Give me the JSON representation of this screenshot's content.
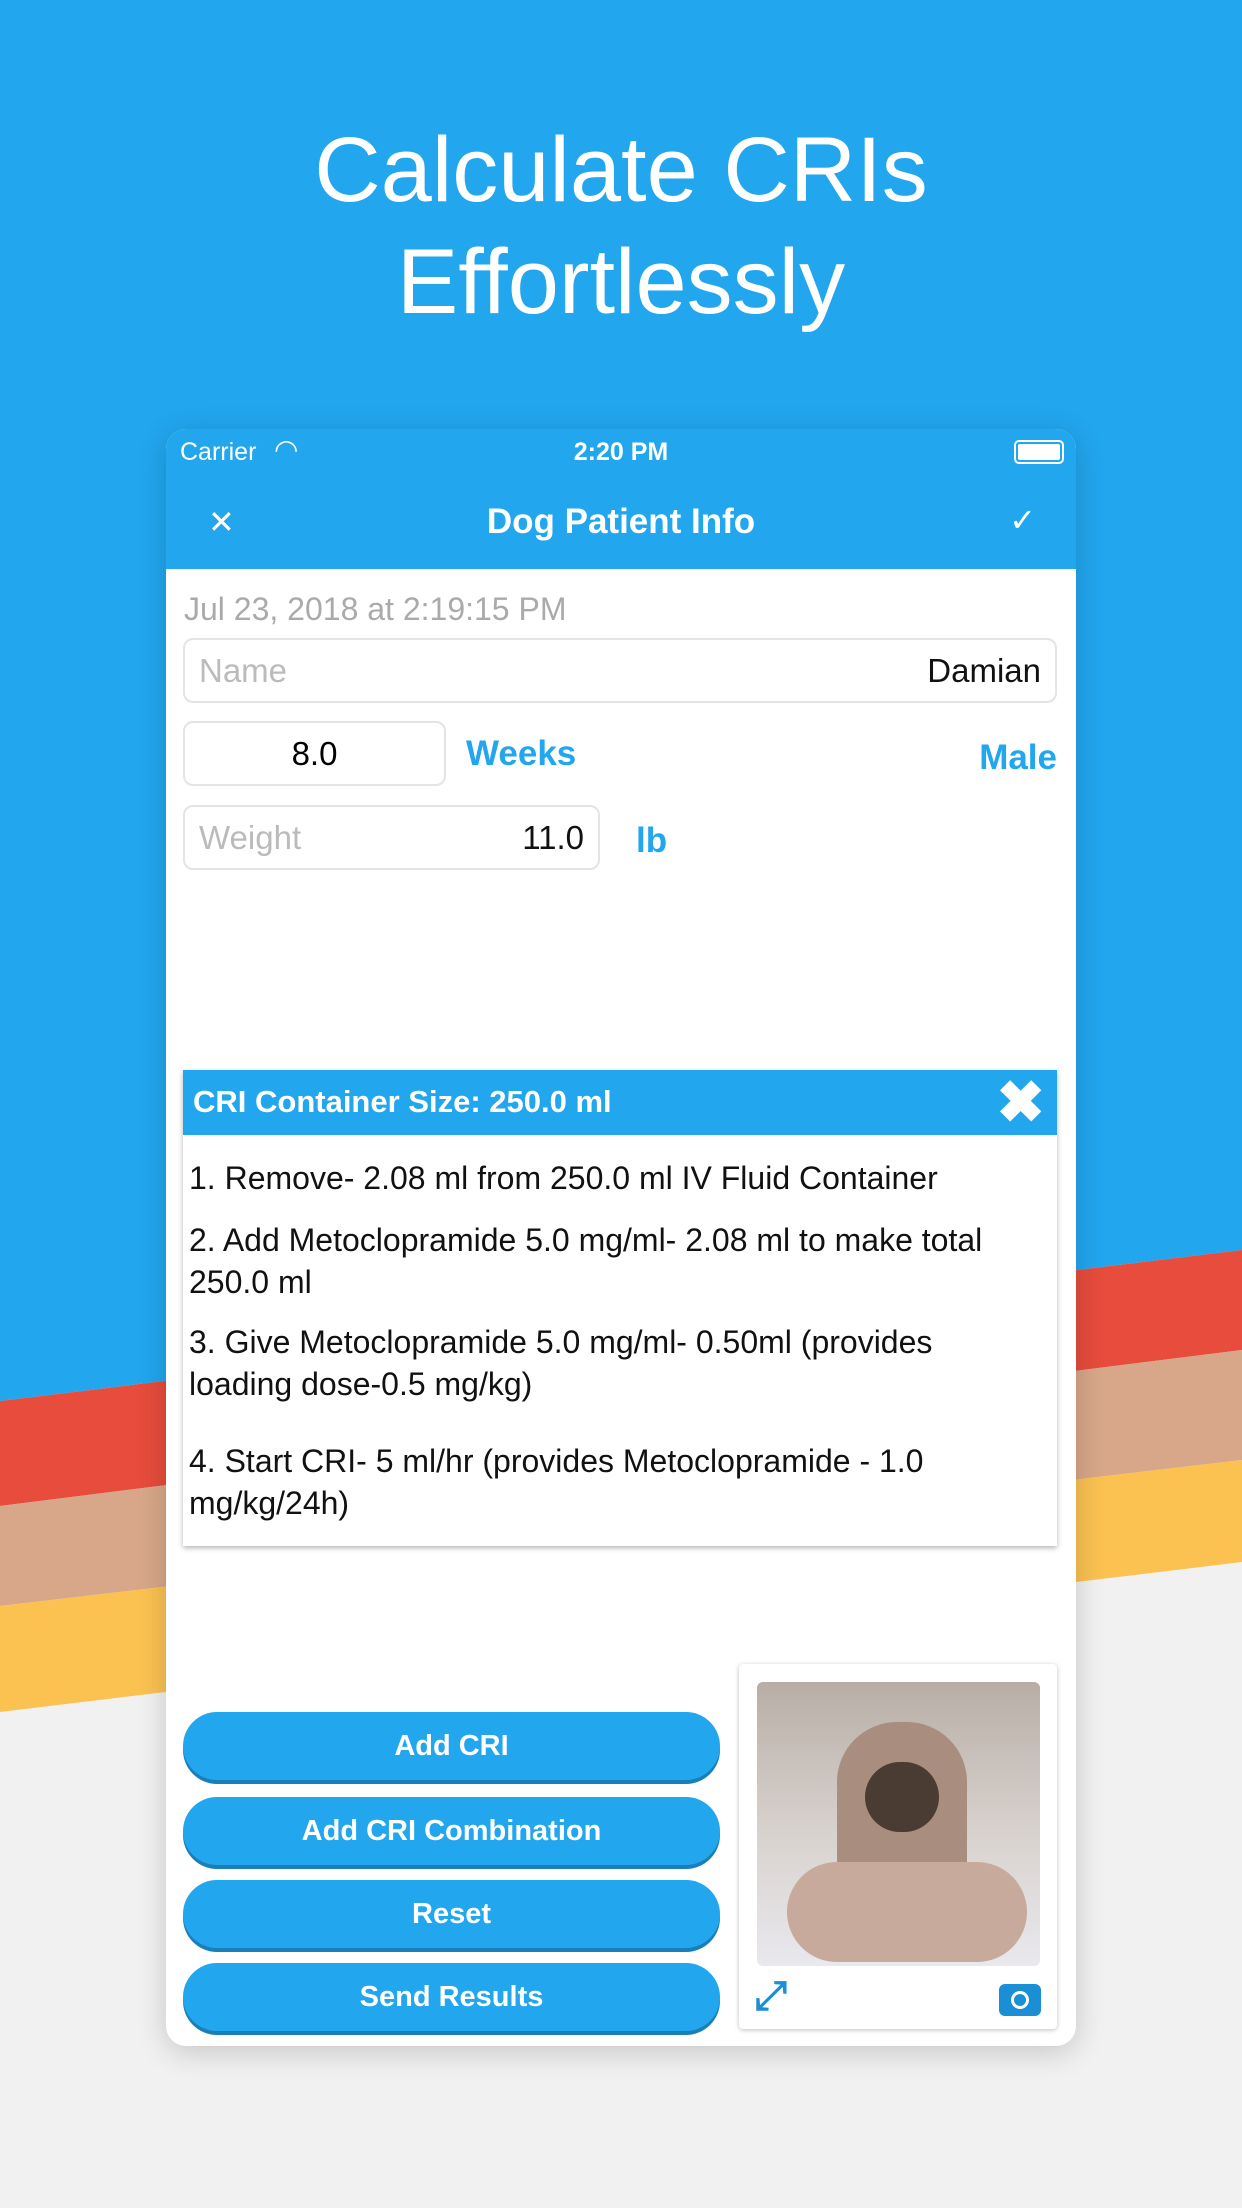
{
  "headline": {
    "line1": "Calculate CRIs",
    "line2": "Effortlessly"
  },
  "colors": {
    "blue": "#22a6ee",
    "red": "#e74c3c",
    "tan": "#d8a789",
    "yellow": "#fbc252",
    "gray": "#f1f1f1"
  },
  "status_bar": {
    "carrier": "Carrier",
    "time": "2:20 PM"
  },
  "nav": {
    "title": "Dog Patient Info",
    "close_icon": "close-icon",
    "done_icon": "checkmark-icon"
  },
  "form": {
    "timestamp": "Jul 23, 2018 at 2:19:15 PM",
    "name": {
      "placeholder": "Name",
      "value": "Damian"
    },
    "age": {
      "value": "8.0",
      "unit": "Weeks"
    },
    "sex": "Male",
    "weight": {
      "placeholder": "Weight",
      "value": "11.0",
      "unit": "lb"
    }
  },
  "cri_card": {
    "title": "CRI Container Size: 250.0 ml",
    "steps": [
      "1. Remove- 2.08 ml from 250.0 ml IV Fluid Container",
      "2. Add Metoclopramide 5.0 mg/ml- 2.08 ml to make total 250.0 ml",
      "3. Give Metoclopramide 5.0 mg/ml- 0.50ml (provides loading dose-0.5 mg/kg)",
      "4. Start CRI- 5 ml/hr (provides Metoclopramide - 1.0 mg/kg/24h)"
    ]
  },
  "buttons": {
    "add_cri": "Add CRI",
    "add_combination": "Add CRI Combination",
    "reset": "Reset",
    "send": "Send Results"
  }
}
